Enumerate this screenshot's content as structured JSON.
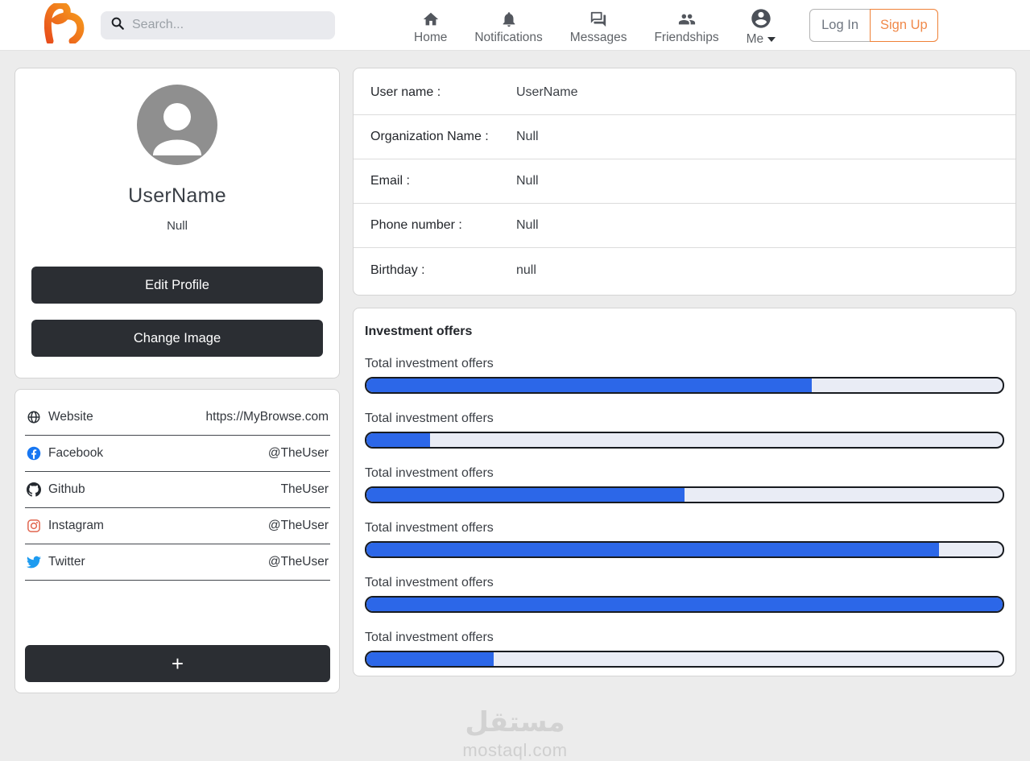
{
  "navbar": {
    "logo_icon": "brand-swirl-icon",
    "search": {
      "placeholder": "Search..."
    },
    "items": [
      {
        "label": "Home",
        "icon": "home-icon"
      },
      {
        "label": "Notifications",
        "icon": "bell-icon"
      },
      {
        "label": "Messages",
        "icon": "messages-icon"
      },
      {
        "label": "Friendships",
        "icon": "friends-icon"
      },
      {
        "label": "Me",
        "icon": "me-avatar-icon"
      }
    ],
    "auth": {
      "login_label": "Log In",
      "signup_label": "Sign Up"
    }
  },
  "profile": {
    "username": "UserName",
    "subtitle": "Null",
    "edit_profile_label": "Edit Profile",
    "change_image_label": "Change Image"
  },
  "social": {
    "links": [
      {
        "name": "Website",
        "icon": "globe-icon",
        "value": "https://MyBrowse.com"
      },
      {
        "name": "Facebook",
        "icon": "facebook-icon",
        "value": "@TheUser"
      },
      {
        "name": "Github",
        "icon": "github-icon",
        "value": "TheUser"
      },
      {
        "name": "Instagram",
        "icon": "instagram-icon",
        "value": "@TheUser"
      },
      {
        "name": "Twitter",
        "icon": "twitter-icon",
        "value": "@TheUser"
      }
    ],
    "add_label": "+"
  },
  "details": {
    "rows": [
      {
        "label": "User name :",
        "value": "UserName"
      },
      {
        "label": "Organization Name :",
        "value": "Null"
      },
      {
        "label": "Email :",
        "value": "Null"
      },
      {
        "label": "Phone number :",
        "value": "Null"
      },
      {
        "label": "Birthday :",
        "value": "null"
      }
    ]
  },
  "investments": {
    "title": "Investment offers",
    "bars": [
      {
        "label": "Total investment offers",
        "percent": 70
      },
      {
        "label": "Total investment offers",
        "percent": 10
      },
      {
        "label": "Total investment offers",
        "percent": 50
      },
      {
        "label": "Total investment offers",
        "percent": 90
      },
      {
        "label": "Total investment offers",
        "percent": 100
      },
      {
        "label": "Total investment offers",
        "percent": 20
      }
    ]
  },
  "watermark": {
    "arabic": "مستقل",
    "latin": "mostaql.com"
  },
  "colors": {
    "accent_orange": "#ef8137",
    "primary_blue": "#2c67e8",
    "dark_button": "#2b2e33",
    "background": "#ececec"
  }
}
